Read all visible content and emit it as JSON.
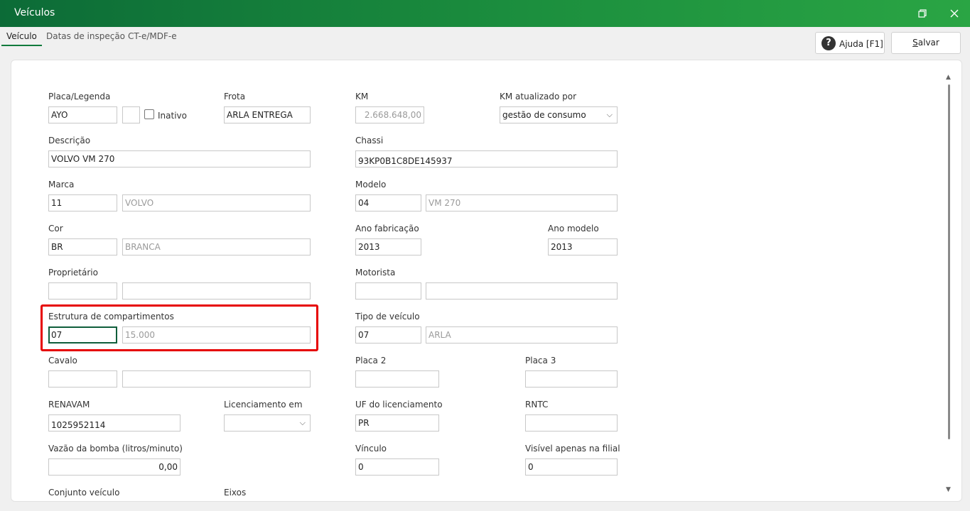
{
  "window": {
    "title": "Veículos"
  },
  "tabs": [
    "Veículo",
    "Datas de inspeção",
    "CT-e/MDF-e"
  ],
  "toolbar": {
    "help_label": "Ajuda [F1]",
    "save_label": "Salvar",
    "help_icon": "?"
  },
  "form": {
    "placa": {
      "label": "Placa/Legenda",
      "value": "AYO",
      "value2": ""
    },
    "inativo": {
      "label": "Inativo",
      "checked": false
    },
    "frota": {
      "label": "Frota",
      "value": "ARLA ENTREGA"
    },
    "km": {
      "label": "KM",
      "value": "2.668.648,00"
    },
    "km_atualizado": {
      "label": "KM atualizado por",
      "value": "gestão de consumo"
    },
    "descricao": {
      "label": "Descrição",
      "value": "VOLVO VM 270"
    },
    "chassi": {
      "label": "Chassi",
      "value": "93KP0B1C8DE145937"
    },
    "marca": {
      "label": "Marca",
      "code": "11",
      "name": "VOLVO"
    },
    "modelo": {
      "label": "Modelo",
      "code": "04",
      "name": "VM 270"
    },
    "cor": {
      "label": "Cor",
      "code": "BR",
      "name": "BRANCA"
    },
    "ano_fabricacao": {
      "label": "Ano fabricação",
      "value": "2013"
    },
    "ano_modelo": {
      "label": "Ano modelo",
      "value": "2013"
    },
    "proprietario": {
      "label": "Proprietário",
      "code": "",
      "name": ""
    },
    "motorista": {
      "label": "Motorista",
      "code": "",
      "name": ""
    },
    "estrutura": {
      "label": "Estrutura de compartimentos",
      "code": "07",
      "name": "15.000"
    },
    "tipo_veiculo": {
      "label": "Tipo de veículo",
      "code": "07",
      "name": "ARLA"
    },
    "cavalo": {
      "label": "Cavalo",
      "code": "",
      "name": ""
    },
    "placa2": {
      "label": "Placa 2",
      "value": ""
    },
    "placa3": {
      "label": "Placa 3",
      "value": ""
    },
    "renavam": {
      "label": "RENAVAM",
      "value": "1025952114"
    },
    "licenciamento": {
      "label": "Licenciamento em",
      "value": ""
    },
    "uf_licenciamento": {
      "label": "UF do licenciamento",
      "value": "PR"
    },
    "rntc": {
      "label": "RNTC",
      "value": ""
    },
    "vazao": {
      "label": "Vazão da bomba (litros/minuto)",
      "value": "0,00"
    },
    "vinculo": {
      "label": "Vínculo",
      "value": "0"
    },
    "visivel_filial": {
      "label": "Visível apenas na filial",
      "value": "0"
    },
    "conjunto": {
      "label": "Conjunto veículo"
    },
    "eixos": {
      "label": "Eixos"
    }
  }
}
